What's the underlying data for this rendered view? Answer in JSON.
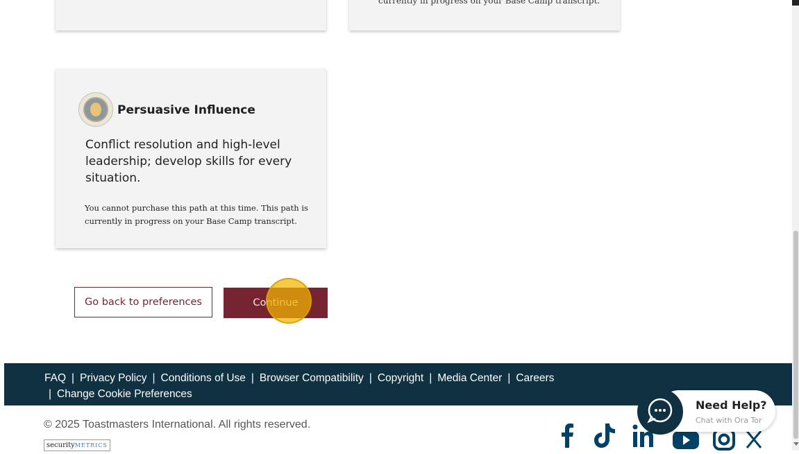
{
  "cards": {
    "top_right_note": "currently in progress on your Base Camp transcript.",
    "main": {
      "title": "Persuasive Influence",
      "description": "Conflict resolution and high-level leadership; develop skills for every situation.",
      "note": "You cannot purchase this path at this time. This path is currently in progress on your Base Camp transcript."
    }
  },
  "buttons": {
    "back_label": "Go back to preferences",
    "continue_label": "Continue"
  },
  "footer": {
    "links": [
      "FAQ",
      "Privacy Policy",
      "Conditions of Use",
      "Browser Compatibility",
      "Copyright",
      "Media Center",
      "Careers",
      "Change Cookie Preferences"
    ],
    "separator": "|",
    "copyright": "© 2025 Toastmasters International.  All rights reserved.",
    "security_logo": {
      "part1": "security",
      "part2": "METRICS"
    },
    "social_icons": [
      "facebook-icon",
      "tiktok-icon",
      "linkedin-icon",
      "youtube-icon",
      "instagram-icon",
      "x-icon"
    ]
  },
  "help_widget": {
    "title": "Need Help?",
    "subtitle": "Chat with Ora Tor"
  },
  "colors": {
    "brand_maroon": "#772432",
    "footer_navy": "#0f3142",
    "social_blue": "#004165",
    "click_marker": "#f2b400"
  }
}
